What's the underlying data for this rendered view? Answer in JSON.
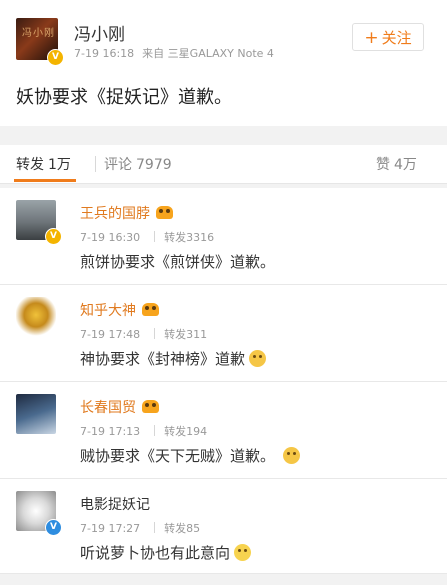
{
  "post": {
    "author": "冯小刚",
    "time": "7-19 16:18",
    "source": "来自 三星GALAXY Note 4",
    "follow_label": "关注",
    "content": "妖协要求《捉妖记》道歉。",
    "avatar_text": "冯小刚"
  },
  "tabs": {
    "repost_label": "转发",
    "repost_count": "1万",
    "comment_label": "评论",
    "comment_count": "7979",
    "like_label": "赞",
    "like_count": "4万"
  },
  "reposts": [
    {
      "name": "王兵的国脖",
      "time": "7-19 16:30",
      "repost_info": "转发3316",
      "text": "煎饼协要求《煎饼侠》道歉。"
    },
    {
      "name": "知乎大神",
      "time": "7-19 17:48",
      "repost_info": "转发311",
      "text": "神协要求《封神榜》道歉"
    },
    {
      "name": "长春国贸",
      "time": "7-19 17:13",
      "repost_info": "转发194",
      "text": "贼协要求《天下无贼》道歉。"
    },
    {
      "name": "电影捉妖记",
      "time": "7-19 17:27",
      "repost_info": "转发85",
      "text": "听说萝卜协也有此意向"
    }
  ],
  "icons": [
    "verified-icon",
    "vip-icon",
    "doge-emoji",
    "grin-emoji",
    "plus-icon"
  ],
  "colors": {
    "accent": "#f07c1b",
    "verified_gold": "#f4b400",
    "verified_blue": "#2e8de0"
  }
}
